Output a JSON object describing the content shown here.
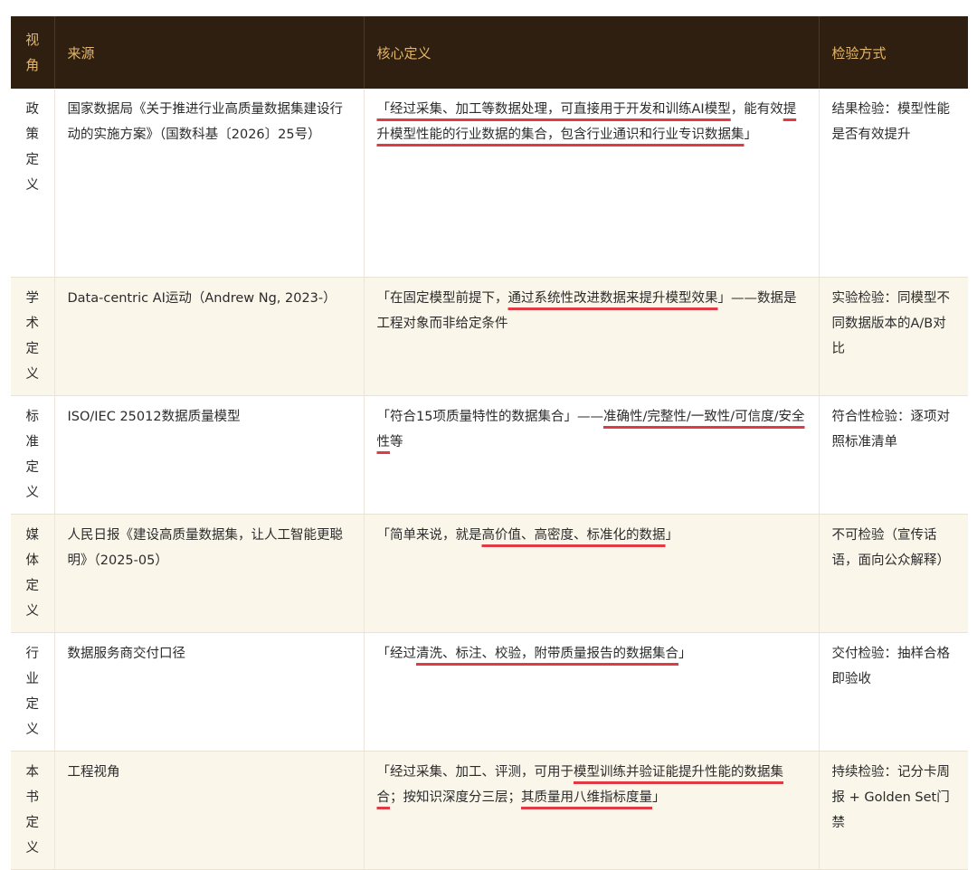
{
  "header": {
    "view": "视角",
    "source": "来源",
    "definition": "核心定义",
    "method": "检验方式"
  },
  "rows": [
    {
      "view": "政策定义",
      "source": "国家数据局《关于推进行业高质量数据集建设行动的实施方案》（国数科基〔2026〕25号）",
      "def_parts": [
        {
          "text": "「经过采集、加工等数据处理，可直接用于开发和训练AI模型",
          "hl": true
        },
        {
          "text": "，能有效",
          "hl": false
        },
        {
          "text": "提升模型性能的行业数据的集合，包含行业通识和行业专识数据集",
          "hl": true
        },
        {
          "text": "」",
          "hl": false
        }
      ],
      "method": "结果检验：模型性能是否有效提升"
    },
    {
      "view": "学术定义",
      "source": "Data-centric AI运动（Andrew Ng, 2023-）",
      "def_parts": [
        {
          "text": "「在固定模型前提下，",
          "hl": false
        },
        {
          "text": "通过系统性改进数据来提升模型效果",
          "hl": true
        },
        {
          "text": "」——数据是工程对象而非给定条件",
          "hl": false
        }
      ],
      "method": "实验检验：同模型不同数据版本的A/B对比"
    },
    {
      "view": "标准定义",
      "source": "ISO/IEC 25012数据质量模型",
      "def_parts": [
        {
          "text": "「符合15项质量特性的数据集合」——",
          "hl": false
        },
        {
          "text": "准确性/完整性/一致性/可信度/安全性",
          "hl": true
        },
        {
          "text": "等",
          "hl": false
        }
      ],
      "method": "符合性检验：逐项对照标准清单"
    },
    {
      "view": "媒体定义",
      "source": "人民日报《建设高质量数据集，让人工智能更聪明》（2025-05）",
      "def_parts": [
        {
          "text": "「简单来说，就是",
          "hl": false
        },
        {
          "text": "高价值、高密度、标准化的数据",
          "hl": true
        },
        {
          "text": "」",
          "hl": false
        }
      ],
      "method": "不可检验（宣传话语，面向公众解释）"
    },
    {
      "view": "行业定义",
      "source": "数据服务商交付口径",
      "def_parts": [
        {
          "text": "「经过",
          "hl": false
        },
        {
          "text": "清洗、标注、校验，附带质量报告的数据集合",
          "hl": true
        },
        {
          "text": "」",
          "hl": false
        }
      ],
      "method": "交付检验：抽样合格即验收"
    },
    {
      "view": "本书定义",
      "source": "工程视角",
      "def_parts": [
        {
          "text": "「经过采集、加工、评测，可用于",
          "hl": false
        },
        {
          "text": "模型训练并验证能提升性能的数据集合",
          "hl": true
        },
        {
          "text": "；按知识深度分三层；",
          "hl": false
        },
        {
          "text": "其质量用八维指标度量",
          "hl": true
        },
        {
          "text": "」",
          "hl": false
        }
      ],
      "method": "持续检验：记分卡周报 + Golden Set门禁"
    }
  ]
}
